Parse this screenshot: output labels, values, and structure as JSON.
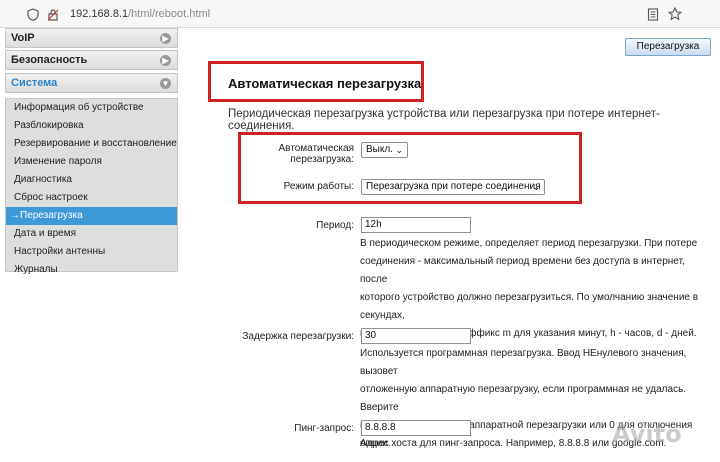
{
  "browser": {
    "url_host": "192.168.8.1",
    "url_path": "/html/reboot.html"
  },
  "sidebar": {
    "sections": [
      {
        "label": "VoIP"
      },
      {
        "label": "Безопасность"
      },
      {
        "label": "Система"
      }
    ],
    "items": [
      {
        "label": "Информация об устройстве"
      },
      {
        "label": "Разблокировка"
      },
      {
        "label": "Резервирование и восстановление"
      },
      {
        "label": "Изменение пароля"
      },
      {
        "label": "Диагностика"
      },
      {
        "label": "Сброс настроек"
      },
      {
        "label": "Перезагрузка"
      },
      {
        "label": "Дата и время"
      },
      {
        "label": "Настройки антенны"
      },
      {
        "label": "Журналы"
      }
    ]
  },
  "main": {
    "reboot_button": "Перезагрузка",
    "title": "Автоматическая перезагрузка",
    "intro": "Периодическая перезагрузка устройства или перезагрузка при потере интернет-соединения.",
    "auto_reboot": {
      "label_line1": "Автоматическая",
      "label_line2": "перезагрузка:",
      "value": "Выкл."
    },
    "mode": {
      "label": "Режим работы:",
      "value": "Перезагрузка при потере соединения"
    },
    "period": {
      "label": "Период:",
      "value": "12h",
      "desc": [
        "В периодическом режиме, определяет период перезагрузки. При потере",
        "соединения - максимальный период времени без доступа в интернет, после",
        "которого устройство должно перезагрузиться. По умолчанию значение в секундах,",
        "можно использовать суффикс m для указания минут, h - часов, d - дней."
      ]
    },
    "delay": {
      "label": "Задержка перезагрузки:",
      "value": "30",
      "desc": [
        "Используется программная перезагрузка. Ввод НЕнулевого значения, вызовет",
        "отложенную аппаратную перезагрузку, если программная не удалась. Вверите",
        "количество секунд для аппаратной перезагрузки или 0 для отключения опции."
      ]
    },
    "ping": {
      "label": "Пинг-запрос:",
      "value": "8.8.8.8",
      "desc": "Адрес хоста для пинг-запроса. Например, 8.8.8.8 или google.com."
    }
  },
  "watermark": "Avito",
  "colors": {
    "highlight_box": "#cc2222",
    "selected_item": "#3d9ad8",
    "active_section": "#2b83c9"
  }
}
